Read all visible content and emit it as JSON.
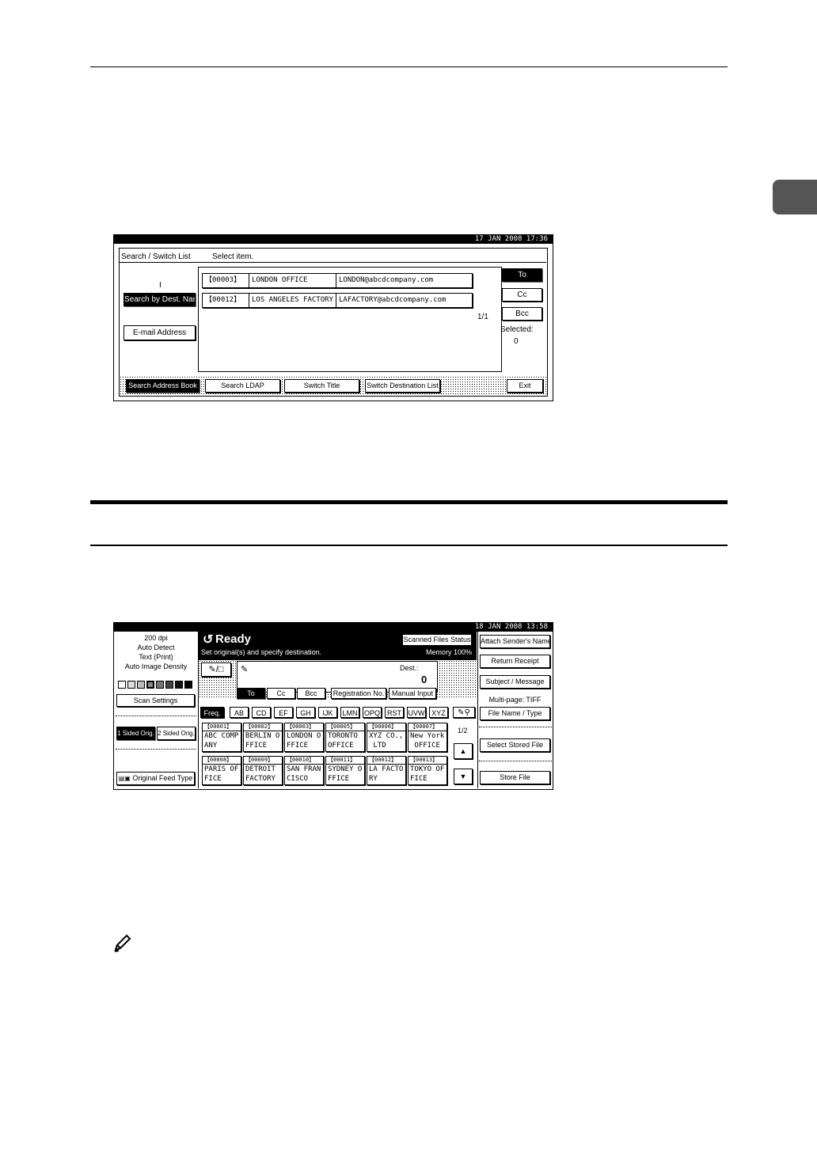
{
  "screen1": {
    "clock": "17  JAN   2008 17:36",
    "title": "Search / Switch List",
    "instruction": "Select item.",
    "marker": "I",
    "search_by_dest_name": "Search by Dest. Name",
    "email_address": "E-mail Address",
    "entries": [
      {
        "id": "【00003】",
        "name": "LONDON OFFICE",
        "email": "LONDON@abcdcompany.com"
      },
      {
        "id": "【00012】",
        "name": "LOS ANGELES FACTORY",
        "email": "LAFACTORY@abcdcompany.com"
      }
    ],
    "page": "1/1",
    "to": "To",
    "cc": "Cc",
    "bcc": "Bcc",
    "selected_label": "Selected:",
    "selected_count": "0",
    "bottom": {
      "search_address_book": "Search Address Book",
      "search_ldap": "Search LDAP",
      "switch_title": "Switch Title",
      "switch_destination_list": "Switch Destination List",
      "exit": "Exit"
    }
  },
  "screen2": {
    "clock": "18  JAN   2008 13:58",
    "settings": [
      "200 dpi",
      "Auto Detect",
      "Text (Print)",
      "Auto Image Density"
    ],
    "scan_settings": "Scan Settings",
    "one_sided": "1 Sided Orig.",
    "two_sided": "2 Sided Orig.",
    "original_feed_type": "Original Feed Type",
    "ready": "Ready",
    "prompt": "Set original(s) and specify destination.",
    "scanned_files_status": "Scanned Files Status",
    "memory": "Memory 100%",
    "dest_label": "Dest.:",
    "dest_count": "0",
    "to": "To",
    "cc": "Cc",
    "bcc": "Bcc",
    "registration_no": "Registration No.",
    "manual_input": "Manual Input",
    "tabs": [
      "Freq.",
      "AB",
      "CD",
      "EF",
      "GH",
      "IJK",
      "LMN",
      "OPQ",
      "RST",
      "UVW",
      "XYZ"
    ],
    "page": "1/2",
    "entries": [
      {
        "id": "【00001】",
        "line1": "ABC COMP",
        "line2": "ANY"
      },
      {
        "id": "【00002】",
        "line1": "BERLIN O",
        "line2": "FFICE"
      },
      {
        "id": "【00003】",
        "line1": "LONDON O",
        "line2": "FFICE"
      },
      {
        "id": "【00005】",
        "line1": "TORONTO",
        "line2": "OFFICE"
      },
      {
        "id": "【00006】",
        "line1": "XYZ CO.,",
        "line2": " LTD"
      },
      {
        "id": "【00007】",
        "line1": "New York",
        "line2": " OFFICE"
      },
      {
        "id": "【00008】",
        "line1": "PARIS OF",
        "line2": "FICE"
      },
      {
        "id": "【00009】",
        "line1": "DETROIT",
        "line2": "FACTORY"
      },
      {
        "id": "【00010】",
        "line1": "SAN FRAN",
        "line2": "CISCO"
      },
      {
        "id": "【00011】",
        "line1": "SYDNEY O",
        "line2": "FFICE"
      },
      {
        "id": "【00012】",
        "line1": "LA FACTO",
        "line2": "RY"
      },
      {
        "id": "【00013】",
        "line1": "TOKYO OF",
        "line2": "FICE"
      }
    ],
    "right": {
      "attach_senders_name": "Attach Sender's Name",
      "return_receipt": "Return Receipt",
      "subject_message": "Subject / Message",
      "multipage": "Multi-page: TIFF",
      "file_name_type": "File Name / Type",
      "select_stored_file": "Select Stored File",
      "store_file": "Store File"
    }
  }
}
